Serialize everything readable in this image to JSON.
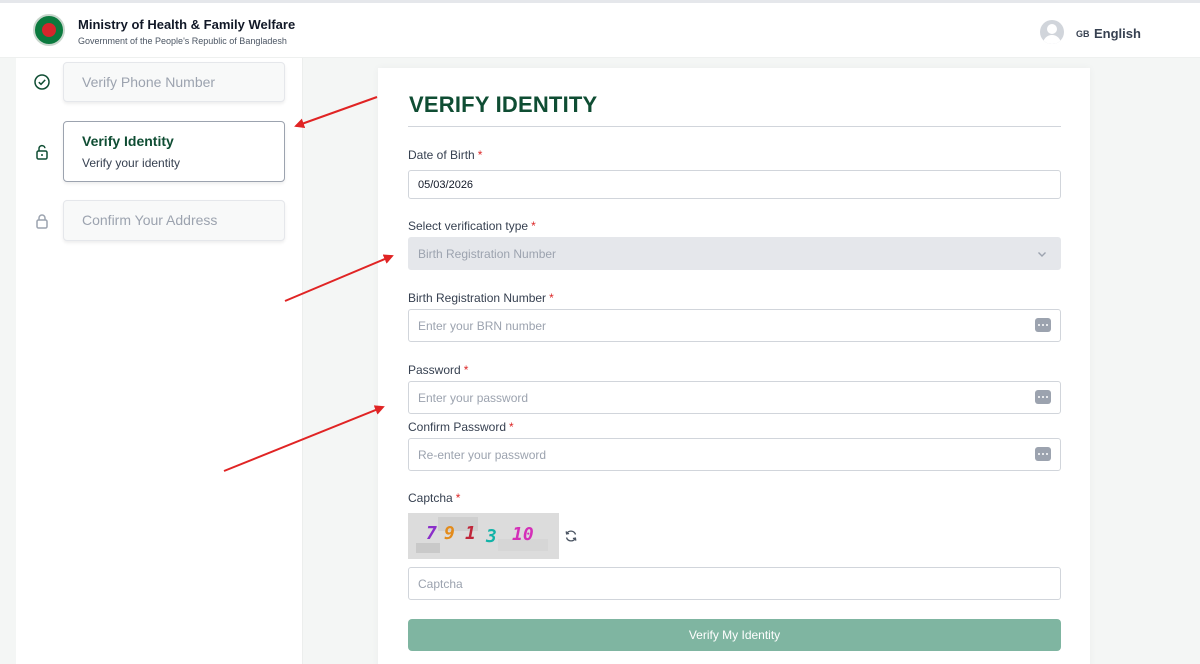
{
  "header": {
    "title": "Ministry of Health & Family Welfare",
    "subtitle": "Government of the People's Republic of Bangladesh",
    "language_flag": "GB",
    "language": "English"
  },
  "steps": [
    {
      "label": "Verify Phone Number",
      "status": "completed"
    },
    {
      "label": "Verify Identity",
      "sublabel": "Verify your identity",
      "status": "active"
    },
    {
      "label": "Confirm Your Address",
      "status": "locked"
    }
  ],
  "form": {
    "title": "VERIFY IDENTITY",
    "required_marker": "*",
    "dob": {
      "label": "Date of Birth",
      "value": "05/03/2026"
    },
    "verification_type": {
      "label": "Select verification type",
      "selected": "Birth Registration Number"
    },
    "brn": {
      "label": "Birth Registration Number",
      "placeholder": "Enter your BRN number"
    },
    "password": {
      "label": "Password",
      "placeholder": "Enter your password"
    },
    "confirm_password": {
      "label": "Confirm Password",
      "placeholder": "Re-enter your password"
    },
    "captcha": {
      "label": "Captcha",
      "characters": [
        "7",
        "9",
        "1",
        "3",
        "10"
      ],
      "placeholder": "Captcha"
    },
    "submit_label": "Verify My Identity"
  },
  "colors": {
    "brand_green": "#0f4d33",
    "button_green": "#7fb5a1",
    "required_red": "#dc2626",
    "annotation_arrow": "#e02424"
  }
}
